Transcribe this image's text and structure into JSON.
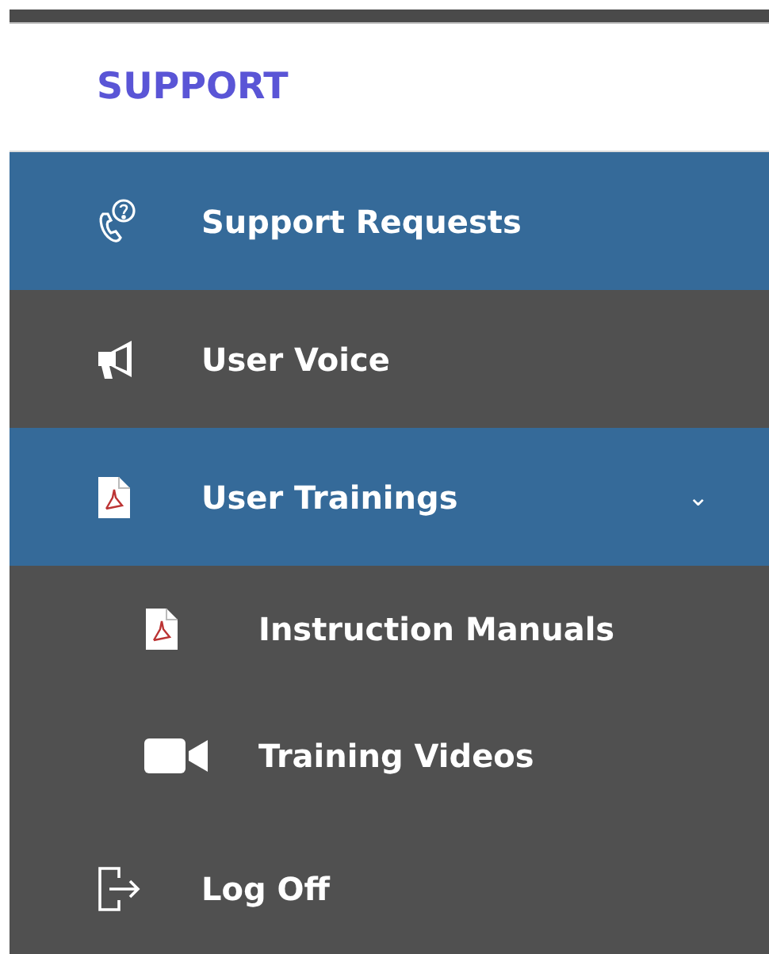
{
  "heading": "SUPPORT",
  "items": [
    {
      "label": "Support Requests",
      "selected": true
    },
    {
      "label": "User Voice",
      "selected": false
    },
    {
      "label": "User Trainings",
      "selected": true,
      "expanded": true,
      "chevron": "⌄",
      "children": [
        {
          "label": "Instruction Manuals",
          "selected": false
        },
        {
          "label": "Training Videos",
          "selected": false
        }
      ]
    },
    {
      "label": "Log Off",
      "selected": false
    }
  ]
}
